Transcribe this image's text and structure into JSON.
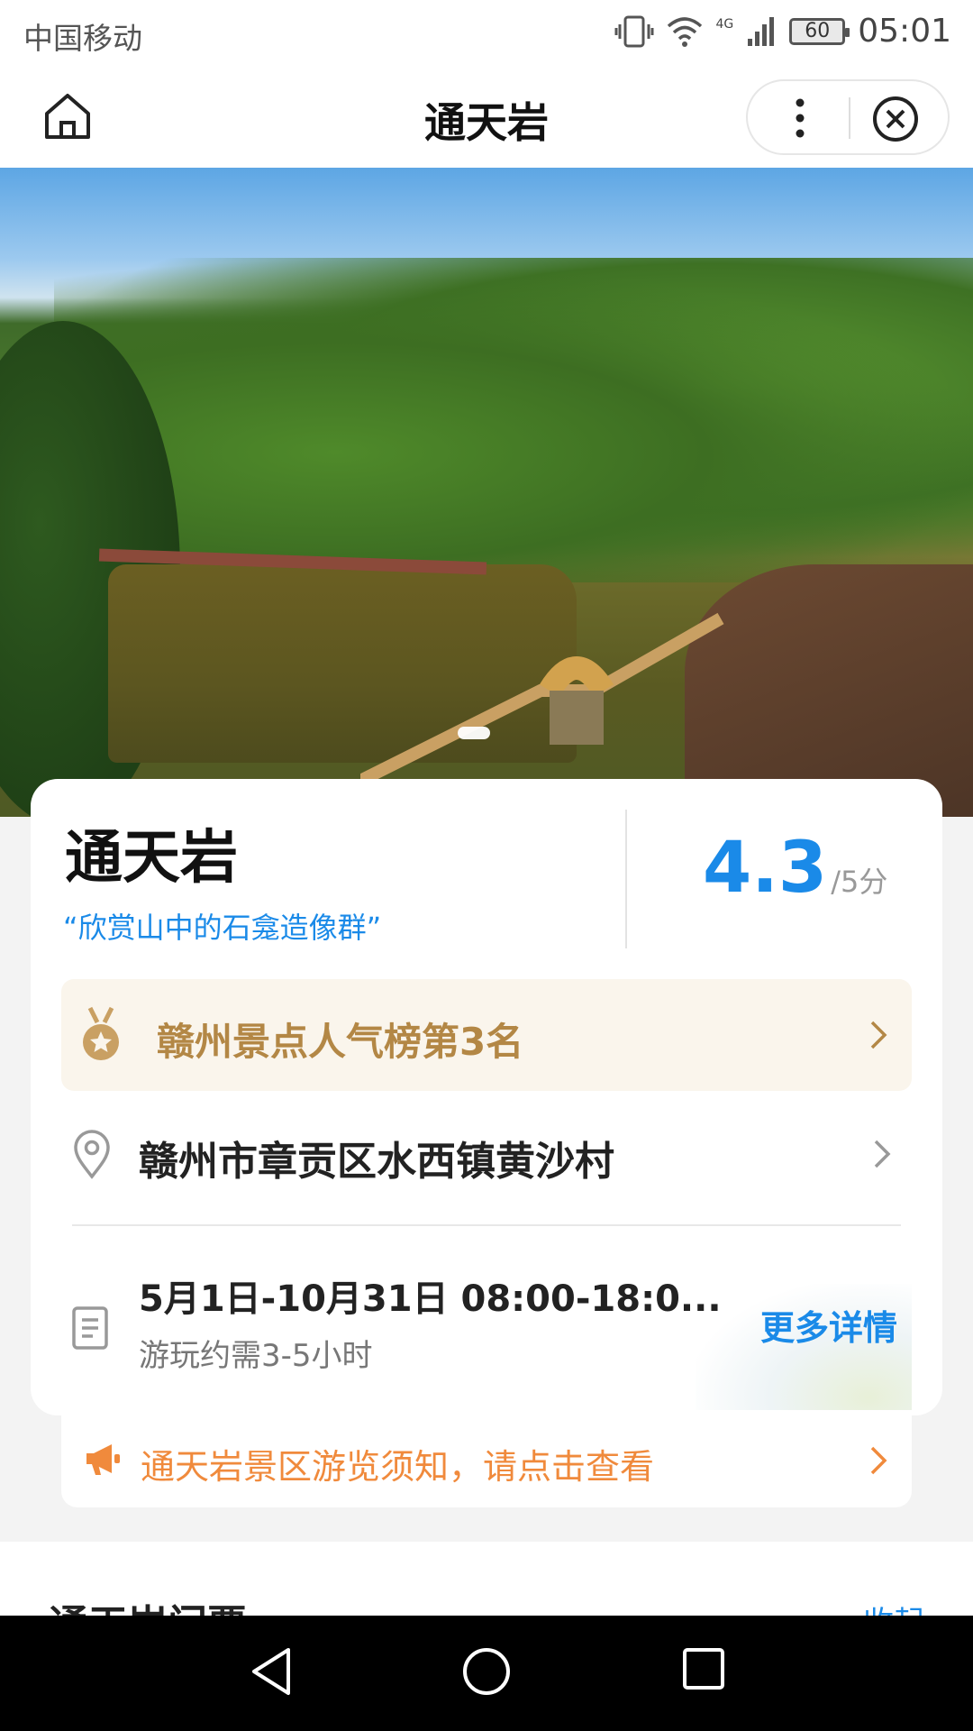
{
  "status_bar": {
    "carrier": "中国移动",
    "network": "4G",
    "battery": "60",
    "time": "05:01"
  },
  "nav": {
    "title": "通天岩",
    "icons": [
      "home-icon",
      "more-icon",
      "close-icon"
    ]
  },
  "hero": {
    "image_subject": "scenic-lake-bridge-photo",
    "slide_count": 1
  },
  "attraction": {
    "name": "通天岩",
    "slogan": "“欣赏山中的石龛造像群”",
    "rating": "4.3",
    "rating_unit": "/5分",
    "rank_label": "赣州景点人气榜第3名",
    "address": "赣州市章贡区水西镇黄沙村",
    "hours": "5月1日-10月31日 08:00-18:0...",
    "duration": "游玩约需3-5小时",
    "more_details": "更多详情"
  },
  "notice": {
    "text": "通天岩景区游览须知，请点击查看"
  },
  "tickets_section": {
    "title": "通天岩门票",
    "collapse_label": "收起"
  },
  "colors": {
    "accent_blue": "#1a8ae8",
    "gold": "#b38745",
    "notice_orange": "#f08a3c"
  }
}
